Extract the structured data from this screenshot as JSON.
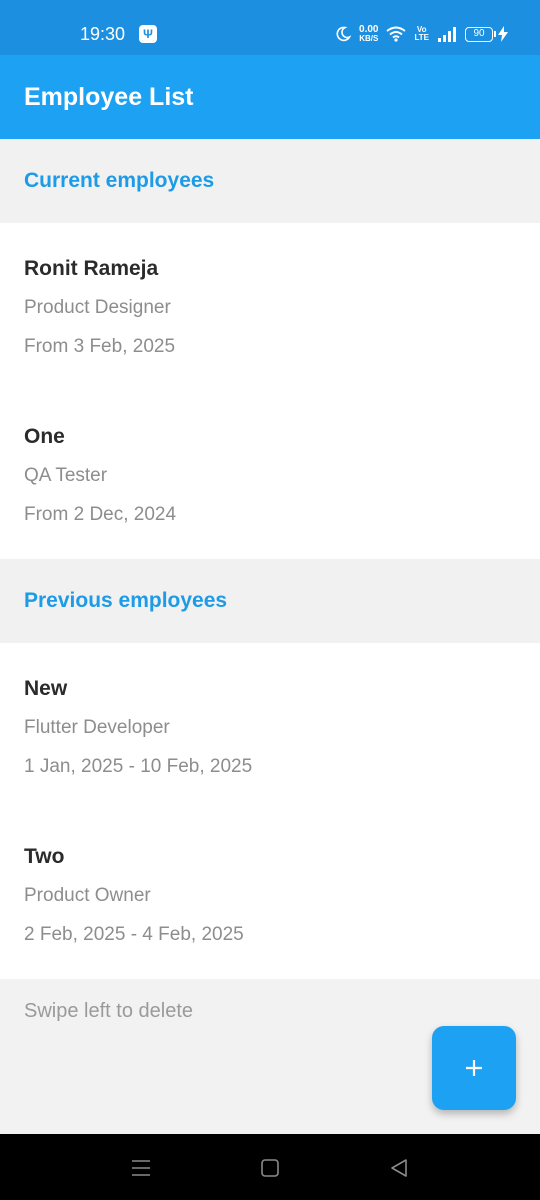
{
  "status_bar": {
    "time": "19:30",
    "usb_icon": "usb-icon",
    "net_speed_value": "0.00",
    "net_speed_unit": "KB/S",
    "volte_top": "Vo",
    "volte_bottom": "LTE",
    "battery_level": "90"
  },
  "app_bar": {
    "title": "Employee List"
  },
  "sections": {
    "current": {
      "title": "Current employees",
      "employees": [
        {
          "name": "Ronit Rameja",
          "role": "Product Designer",
          "date": "From 3 Feb, 2025"
        },
        {
          "name": "One",
          "role": "QA Tester",
          "date": "From 2 Dec, 2024"
        }
      ]
    },
    "previous": {
      "title": "Previous employees",
      "employees": [
        {
          "name": "New",
          "role": "Flutter Developer",
          "date": "1 Jan, 2025 - 10 Feb, 2025"
        },
        {
          "name": "Two",
          "role": "Product Owner",
          "date": "2 Feb, 2025 - 4 Feb, 2025"
        }
      ]
    }
  },
  "hint": "Swipe left to delete",
  "fab": {
    "icon": "plus-icon"
  },
  "nav": {
    "recents_icon": "menu-icon",
    "home_icon": "square-icon",
    "back_icon": "back-triangle-icon"
  },
  "colors": {
    "status_bar": "#1d8fe0",
    "app_bar": "#1da1f2",
    "accent_text": "#1d9be6",
    "fab": "#1da1f2"
  }
}
